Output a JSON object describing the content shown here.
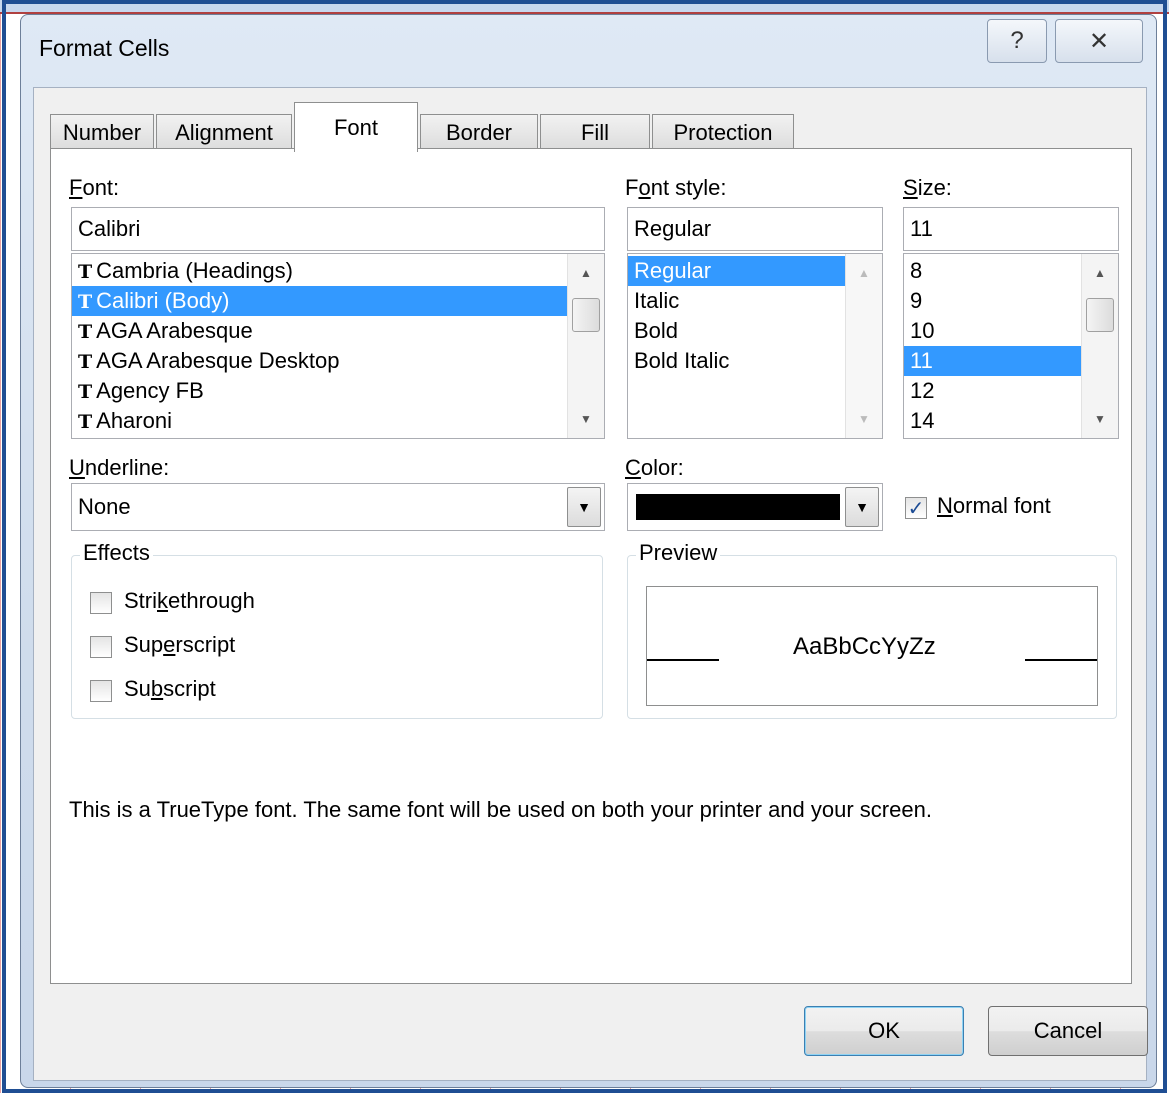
{
  "dialog": {
    "title": "Format Cells",
    "help_glyph": "?",
    "close_glyph": "✕"
  },
  "tabs": [
    {
      "label": "Number"
    },
    {
      "label": "Alignment"
    },
    {
      "label": "Font",
      "active": true
    },
    {
      "label": "Border"
    },
    {
      "label": "Fill"
    },
    {
      "label": "Protection"
    }
  ],
  "font": {
    "label": "Font:",
    "value": "Calibri",
    "items": [
      "Cambria (Headings)",
      "Calibri (Body)",
      "AGA Arabesque",
      "AGA Arabesque Desktop",
      "Agency FB",
      "Aharoni"
    ],
    "selected": "Calibri (Body)"
  },
  "font_style": {
    "label": "Font style:",
    "value": "Regular",
    "items": [
      "Regular",
      "Italic",
      "Bold",
      "Bold Italic"
    ],
    "selected": "Regular"
  },
  "size": {
    "label": "Size:",
    "value": "11",
    "items": [
      "8",
      "9",
      "10",
      "11",
      "12",
      "14"
    ],
    "selected": "11"
  },
  "underline": {
    "label": "Underline:",
    "value": "None"
  },
  "color": {
    "label": "Color:",
    "value": "#000000"
  },
  "normal_font": {
    "label": "Normal font",
    "checked": true
  },
  "effects": {
    "title": "Effects",
    "strikethrough": {
      "label": "Strikethrough",
      "checked": false
    },
    "superscript": {
      "label": "Superscript",
      "checked": false
    },
    "subscript": {
      "label": "Subscript",
      "checked": false
    }
  },
  "preview": {
    "title": "Preview",
    "sample": "AaBbCcYyZz"
  },
  "info_text": "This is a TrueType font.  The same font will be used on both your printer and your screen.",
  "buttons": {
    "ok": "OK",
    "cancel": "Cancel"
  },
  "colors": {
    "selection": "#3399ff",
    "window_frame": "#1f4e93"
  }
}
